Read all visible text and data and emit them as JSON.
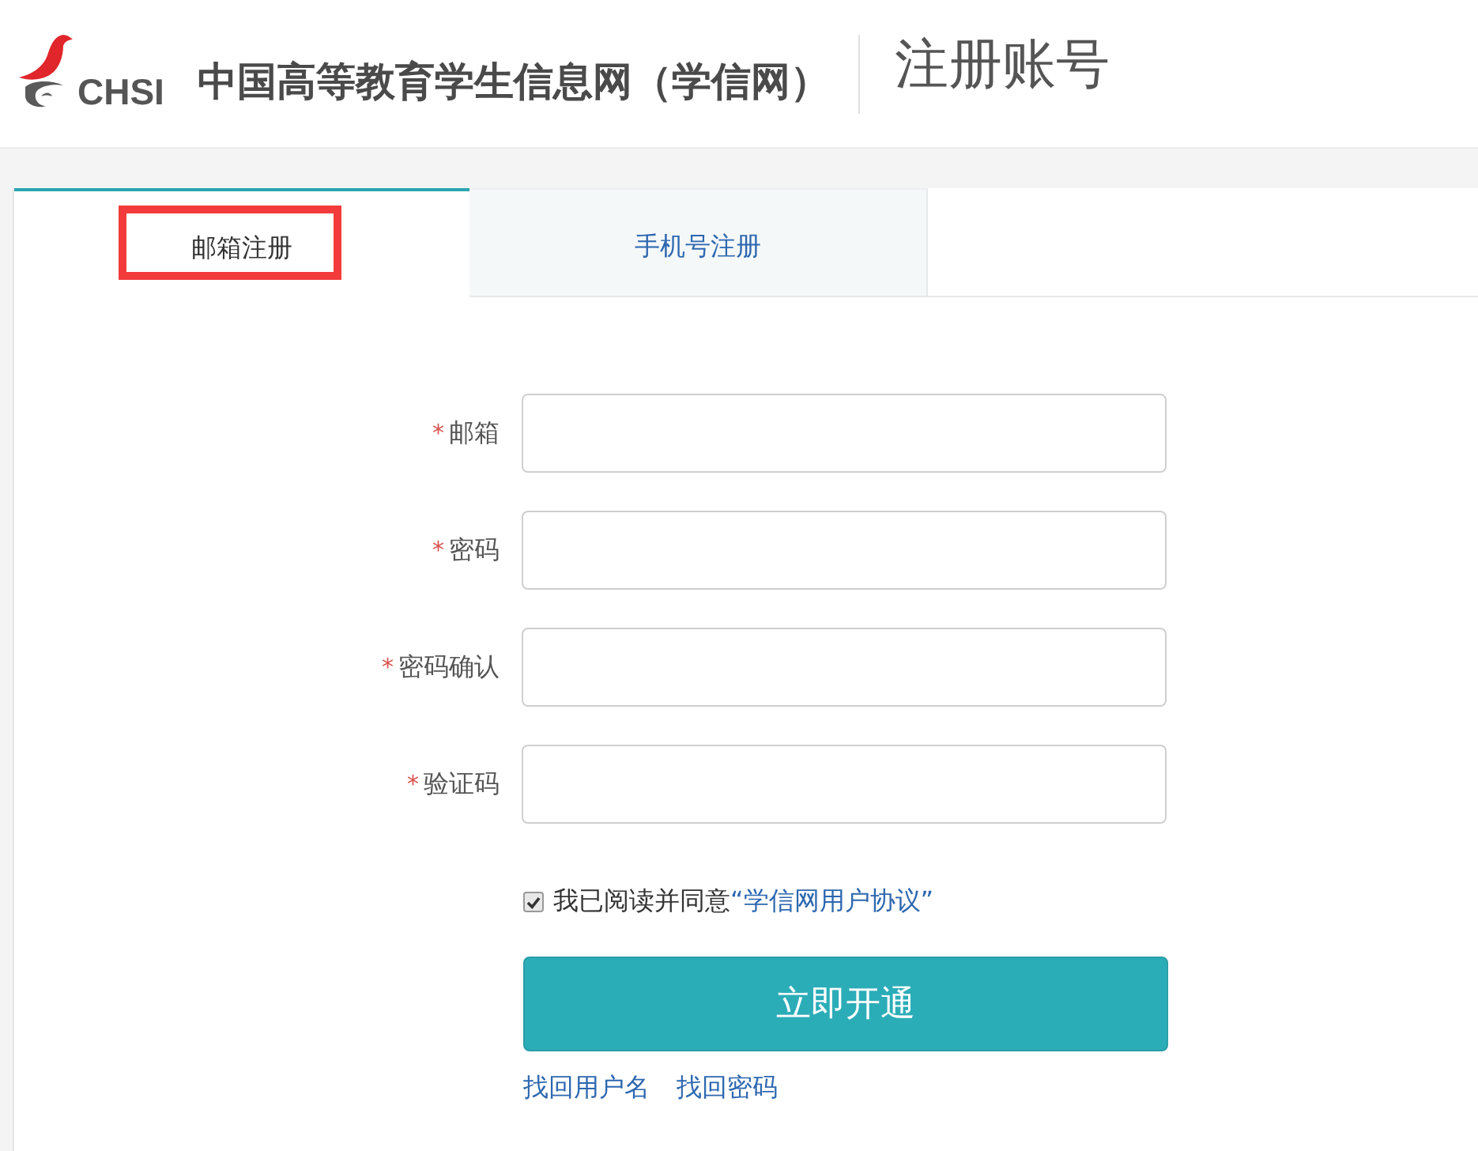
{
  "header": {
    "logo_text": "CHSI",
    "site_name": "中国高等教育学生信息网（学信网）",
    "page_title": "注册账号"
  },
  "tabs": [
    {
      "label": "邮箱注册",
      "selected": true,
      "highlighted": true
    },
    {
      "label": "手机号注册",
      "selected": false,
      "highlighted": false
    }
  ],
  "fields": [
    {
      "required_mark": "*",
      "label": "邮箱"
    },
    {
      "required_mark": "*",
      "label": "密码"
    },
    {
      "required_mark": "*",
      "label": "密码确认"
    },
    {
      "required_mark": "*",
      "label": "验证码"
    }
  ],
  "agreement": {
    "checked": true,
    "text": "我已阅读并同意",
    "link": "“学信网用户协议”"
  },
  "submit_button": "立即开通",
  "links": [
    "找回用户名",
    "找回密码"
  ]
}
